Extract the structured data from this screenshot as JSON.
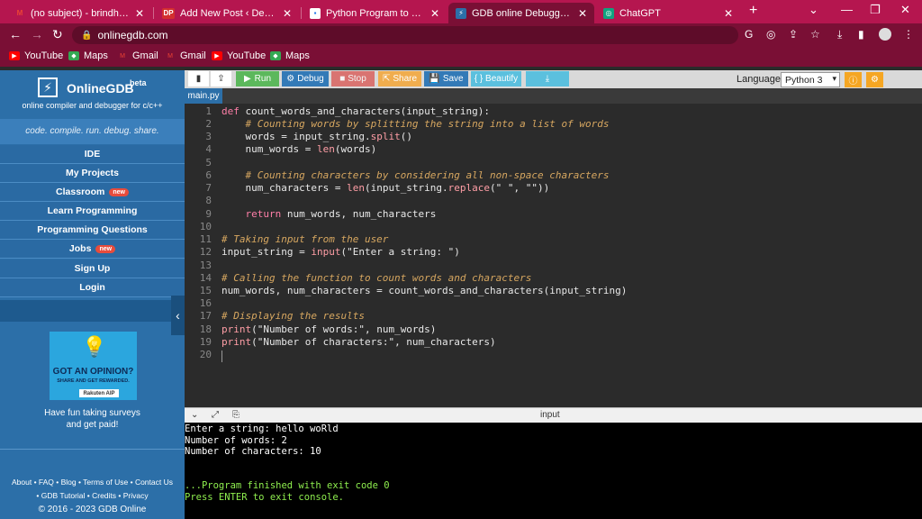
{
  "browser": {
    "tabs": [
      {
        "title": "(no subject) - brindhaprathal",
        "icon": "gmail-icon"
      },
      {
        "title": "Add New Post ‹ Developer Pu",
        "icon": "dp-icon"
      },
      {
        "title": "Python Program to Count the",
        "icon": "page-icon"
      },
      {
        "title": "GDB online Debugger | Comp",
        "icon": "gdb-icon"
      },
      {
        "title": "ChatGPT",
        "icon": "chatgpt-icon"
      }
    ],
    "url": "onlinegdb.com",
    "bookmarks": [
      "YouTube",
      "Maps",
      "Gmail",
      "Gmail",
      "YouTube",
      "Maps"
    ],
    "colors": {
      "tabbar": "#b5164f",
      "toolbar": "#7a0f35"
    }
  },
  "sidebar": {
    "brand": "OnlineGDB",
    "beta": "beta",
    "subtitle": "online compiler and debugger for c/c++",
    "tagline": "code. compile. run. debug. share.",
    "menu": [
      {
        "label": "IDE",
        "badge": ""
      },
      {
        "label": "My Projects",
        "badge": ""
      },
      {
        "label": "Classroom",
        "badge": "new"
      },
      {
        "label": "Learn Programming",
        "badge": ""
      },
      {
        "label": "Programming Questions",
        "badge": ""
      },
      {
        "label": "Jobs",
        "badge": "new"
      },
      {
        "label": "Sign Up",
        "badge": ""
      },
      {
        "label": "Login",
        "badge": ""
      }
    ],
    "ad": {
      "headline": "GOT AN OPINION?",
      "sub": "SHARE AND GET REWARDED.",
      "brand": "Rakuten AIP",
      "caption1": "Have fun taking surveys",
      "caption2": "and get paid!"
    },
    "footer": {
      "line1": "About • FAQ • Blog • Terms of Use • Contact Us",
      "line2": "• GDB Tutorial • Credits • Privacy",
      "line3": "© 2016 - 2023 GDB Online"
    }
  },
  "toolbar": {
    "run": "Run",
    "debug": "Debug",
    "stop": "Stop",
    "share": "Share",
    "save": "Save",
    "beautify": "{ } Beautify",
    "language_label": "Language",
    "language": "Python 3",
    "colors": {
      "run": "#5cb85c",
      "debug": "#337ab7",
      "stop": "#d9534f",
      "share": "#f0ad4e",
      "save": "#337ab7",
      "beautify": "#5bc0de",
      "download": "#5bc0de"
    }
  },
  "editor": {
    "filename": "main.py",
    "lines": [
      "1",
      "2",
      "3",
      "4",
      "5",
      "6",
      "7",
      "8",
      "9",
      "10",
      "11",
      "12",
      "13",
      "14",
      "15",
      "16",
      "17",
      "18",
      "19",
      "20"
    ],
    "code": {
      "l1_kw": "def ",
      "l1_rest": "count_words_and_characters(input_string):",
      "l2": "    # Counting words by splitting the string into a list of words",
      "l3_a": "    words = input_string.",
      "l3_fn": "split",
      "l3_b": "()",
      "l4_a": "    num_words = ",
      "l4_fn": "len",
      "l4_b": "(words)",
      "l6": "    # Counting characters by considering all non-space characters",
      "l7_a": "    num_characters = ",
      "l7_fn": "len",
      "l7_b": "(input_string.",
      "l7_fn2": "replace",
      "l7_c": "(\" \", \"\"))",
      "l9_kw": "    return ",
      "l9_rest": "num_words, num_characters",
      "l11": "# Taking input from the user",
      "l12_a": "input_string = ",
      "l12_fn": "input",
      "l12_b": "(\"Enter a string: \")",
      "l14": "# Calling the function to count words and characters",
      "l15": "num_words, num_characters = count_words_and_characters(input_string)",
      "l17": "# Displaying the results",
      "l18_fn": "print",
      "l18_b": "(\"Number of words:\", num_words)",
      "l19_fn": "print",
      "l19_b": "(\"Number of characters:\", num_characters)"
    }
  },
  "console": {
    "title": "input",
    "lines": [
      "Enter a string: hello woRld",
      "Number of words: 2",
      "Number of characters: 10"
    ],
    "finished": "...Program finished with exit code 0",
    "press": "Press ENTER to exit console."
  }
}
